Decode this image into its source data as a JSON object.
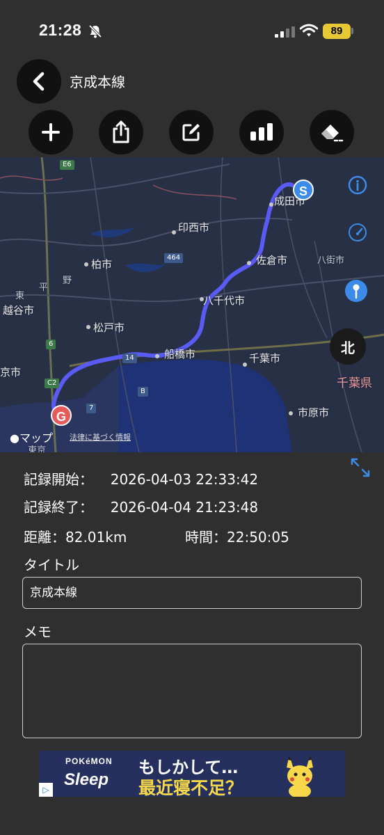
{
  "status": {
    "time": "21:28",
    "battery": "89"
  },
  "header": {
    "title": "京成本線"
  },
  "toolbar": {
    "buttons": [
      {
        "name": "add-button",
        "icon": "plus-icon"
      },
      {
        "name": "share-button",
        "icon": "share-icon"
      },
      {
        "name": "edit-button",
        "icon": "edit-icon"
      },
      {
        "name": "stats-button",
        "icon": "bar-chart-icon"
      },
      {
        "name": "eraser-button",
        "icon": "eraser-icon"
      }
    ]
  },
  "map": {
    "labels": {
      "narita": "成田市",
      "inzai": "印西市",
      "kashiwa": "柏市",
      "sakura": "佐倉市",
      "yachimata": "八街市",
      "yachiyo": "八千代市",
      "koshigaya": "越谷市",
      "matsudo": "松戸市",
      "funabashi": "船橋市",
      "chiba": "千葉市",
      "chiba_pref": "千葉県",
      "ichihara": "市原市",
      "tokyo_edge": "京市",
      "tokyo_bottom": "東京",
      "higashi": "東",
      "hira": "平",
      "no": "野"
    },
    "shields": [
      "E6",
      "464",
      "6",
      "14",
      "C2",
      "B",
      "7"
    ],
    "start_pin": "S",
    "goal_pin": "G",
    "compass": "北",
    "attribution": "マップ",
    "legal": "法律に基づく情報",
    "route_color": "#5a5af5"
  },
  "record": {
    "start_label": "記録開始：",
    "start_value": "2026-04-03 22:33:42",
    "end_label": "記録終了：",
    "end_value": "2026-04-04 21:23:48",
    "distance_label": "距離：",
    "distance_value": "82.01km",
    "duration_label": "時間：",
    "duration_value": "22:50:05"
  },
  "form": {
    "title_label": "タイトル",
    "title_value": "京成本線",
    "memo_label": "メモ",
    "memo_value": ""
  },
  "ad": {
    "brand_top": "POKéMON",
    "brand_bottom": "Sleep",
    "line1": "もしかして…",
    "line2": "最近寝不足？"
  }
}
